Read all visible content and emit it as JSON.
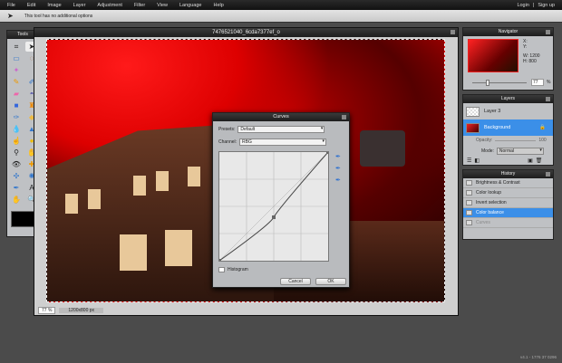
{
  "menu": {
    "items": [
      "File",
      "Edit",
      "Image",
      "Layer",
      "Adjustment",
      "Filter",
      "View",
      "Language",
      "Help"
    ],
    "login": "Login",
    "separator": "|",
    "signup": "Sign up"
  },
  "options": {
    "hint": "This tool has no additional options"
  },
  "tools": {
    "title": "Tools"
  },
  "document": {
    "title": "7476521040_6cda7377ef_o",
    "zoom": "77",
    "zoom_unit": "%",
    "size": "1200x800 px"
  },
  "curves": {
    "title": "Curves",
    "presets_label": "Presets:",
    "presets_value": "Default",
    "channel_label": "Channel:",
    "channel_value": "RBG",
    "histogram_label": "Histogram",
    "cancel": "Cancel",
    "ok": "OK",
    "points": [
      [
        0,
        0
      ],
      [
        0.5,
        0.4
      ],
      [
        1,
        1
      ]
    ]
  },
  "navigator": {
    "title": "Navigator",
    "x_label": "X:",
    "y_label": "Y:",
    "w_label": "W:",
    "w_value": "1200",
    "h_label": "H:",
    "h_value": "800",
    "zoom": "77",
    "zoom_unit": "%"
  },
  "layers": {
    "title": "Layers",
    "items": [
      {
        "name": "Layer 3",
        "selected": false
      },
      {
        "name": "Background",
        "selected": true
      }
    ],
    "opacity_label": "Opacity:",
    "opacity_value": "100",
    "mode_label": "Mode:",
    "mode_value": "Normal"
  },
  "history": {
    "title": "History",
    "items": [
      "Brightness & Contrast",
      "Color lookup",
      "Invert selection",
      "Color balance",
      "Curves"
    ],
    "selected_index": 3
  },
  "version": "v4.1 - 1776 37 0296",
  "colors": {
    "accent": "#3b8fe8",
    "background": "#4b4b4b"
  }
}
